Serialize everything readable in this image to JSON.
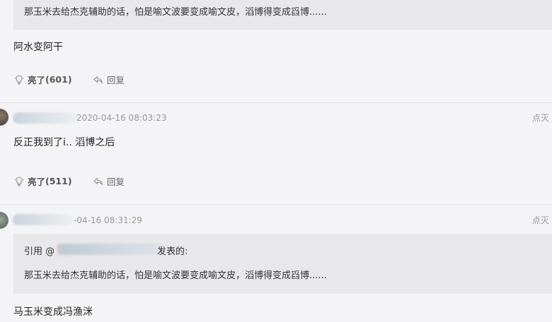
{
  "comment1": {
    "quote_text": "那玉米去给杰克辅助的话，怕是喻文波要变成喻文皮，滔博得变成舀博......",
    "text": "阿水变阿干",
    "like_label": "亮了",
    "like_count": "(601)",
    "reply_label": "回复"
  },
  "comment2": {
    "time": "2020-04-16 08:03:23",
    "report_label": "点灭",
    "text": "反正我到了i.. 滔博之后",
    "like_label": "亮了",
    "like_count": "(511)",
    "reply_label": "回复"
  },
  "comment3": {
    "time": "-04-16 08:31:29",
    "report_label": "点灭",
    "quote_prefix": "引用 @",
    "quote_suffix": "发表的:",
    "quote_text": "那玉米去给杰克辅助的话，怕是喻文波要变成喻文皮，滔博得变成舀博......",
    "text": "马玉米变成冯渔洣"
  },
  "icons": {
    "like": "lightbulb-icon",
    "reply": "reply-arrow-icon"
  },
  "colors": {
    "background": "#f4f4f6",
    "quote_background": "#e8e8ea",
    "meta_text": "#999999"
  }
}
